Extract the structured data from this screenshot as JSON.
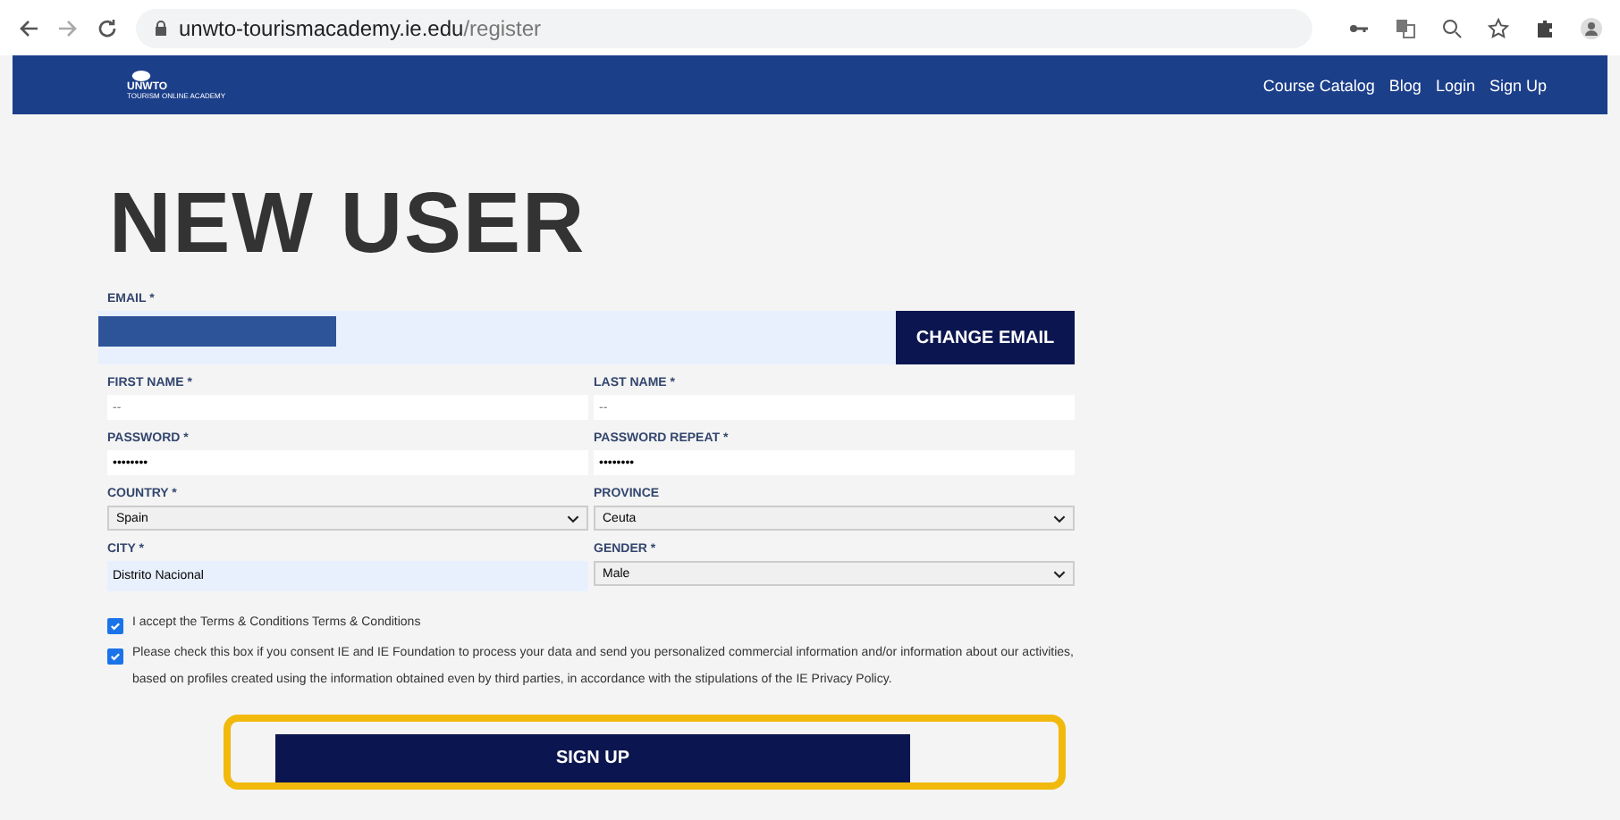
{
  "browser": {
    "url_host": "unwto-tourismacademy.ie.edu",
    "url_path": "/register"
  },
  "nav": {
    "logo_title": "UNWTO",
    "logo_subtitle": "TOURISM ONLINE ACADEMY",
    "links": [
      "Course Catalog",
      "Blog",
      "Login",
      "Sign Up"
    ]
  },
  "heading": "NEW USER",
  "email": {
    "label": "EMAIL *",
    "button": "CHANGE EMAIL"
  },
  "fields": [
    {
      "kind": "input",
      "label": "FIRST NAME *",
      "placeholder": "--"
    },
    {
      "kind": "input",
      "label": "LAST NAME *",
      "placeholder": "--"
    },
    {
      "kind": "input",
      "label": "PASSWORD *",
      "value": "••••••••"
    },
    {
      "kind": "input",
      "label": "PASSWORD REPEAT *",
      "value": "••••••••"
    },
    {
      "kind": "select",
      "label": "COUNTRY *",
      "value": "Spain"
    },
    {
      "kind": "select",
      "label": "PROVINCE",
      "value": "Ceuta"
    },
    {
      "kind": "autofill",
      "label": "CITY *",
      "value": "Distrito Nacional"
    },
    {
      "kind": "select",
      "label": "GENDER *",
      "value": "Male"
    }
  ],
  "checkboxes": [
    {
      "text": "I accept the Terms & Conditions Terms & Conditions",
      "checked": true
    },
    {
      "text": "Please check this box if you consent IE and IE Foundation to process your data and send you personalized commercial information and/or information about our activities, based on profiles created using the information obtained even by third parties, in accordance with the stipulations of the IE Privacy Policy.",
      "checked": true
    }
  ],
  "submit": "SIGN UP"
}
